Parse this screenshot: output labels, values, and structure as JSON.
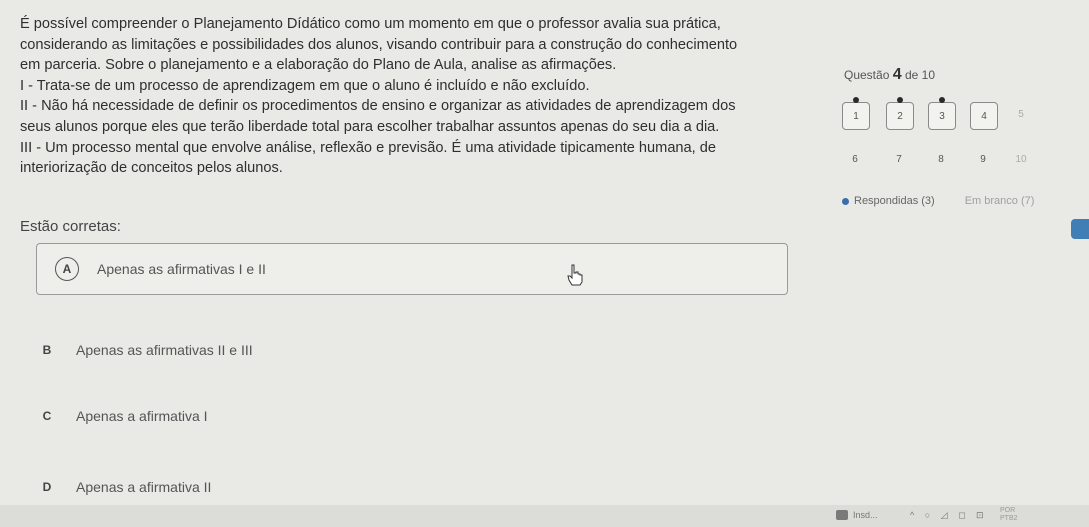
{
  "question": {
    "paragraphs": [
      "É possível compreender o Planejamento Dídático como um momento em que o professor avalia sua prática,",
      "considerando as limitações e possibilidades dos alunos, visando contribuir para a construção do conhecimento",
      "em parceria. Sobre o planejamento e a elaboração do Plano de Aula, analise as afirmações.",
      "I - Trata-se de um processo de aprendizagem em que o aluno é incluído e não excluído.",
      "II - Não há necessidade de definir os procedimentos de ensino e organizar as atividades de aprendizagem dos",
      "seus alunos porque eles que terão liberdade total para escolher trabalhar assuntos apenas do seu dia a dia.",
      "III - Um processo mental que envolve análise, reflexão e previsão. É uma atividade tipicamente humana, de",
      "interiorização de conceitos pelos alunos."
    ],
    "prompt": "Estão corretas:"
  },
  "options": [
    {
      "letter": "A",
      "text": "Apenas as afirmativas I e II"
    },
    {
      "letter": "B",
      "text": "Apenas as afirmativas II e III"
    },
    {
      "letter": "C",
      "text": "Apenas a afirmativa I"
    },
    {
      "letter": "D",
      "text": "Apenas a afirmativa II"
    }
  ],
  "navigator": {
    "label_prefix": "Questão",
    "current": "4",
    "label_suffix": "de 10",
    "questions": [
      "1",
      "2",
      "3",
      "4",
      "5",
      "6",
      "7",
      "8",
      "9",
      "10"
    ],
    "answered": [
      "1",
      "2",
      "3"
    ],
    "legend_answered": "Respondidas (3)",
    "legend_blank": "Em branco (7)"
  },
  "taskbar": {
    "app_label": "Insd...",
    "clock_line1": "POR",
    "clock_line2": "PTB2"
  },
  "colors": {
    "accent": "#3a6ea8",
    "background": "#e9e9e6"
  }
}
